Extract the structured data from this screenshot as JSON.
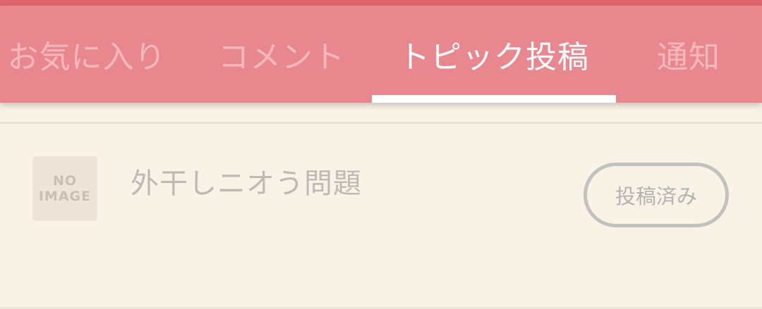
{
  "tabs": [
    {
      "label": "お気に入り",
      "active": false
    },
    {
      "label": "コメント",
      "active": false
    },
    {
      "label": "トピック投稿",
      "active": true
    },
    {
      "label": "通知",
      "active": false
    }
  ],
  "topics": [
    {
      "thumbnail": {
        "line1": "NO",
        "line2": "IMAGE"
      },
      "title": "外干しニオう問題",
      "status": "投稿済み"
    }
  ],
  "colors": {
    "tab_bar": "#e8878d",
    "top_strip": "#e0666e",
    "background": "#f8f2e7",
    "tab_inactive_text": "#f4b8bc",
    "tab_active_text": "#ffffff"
  }
}
